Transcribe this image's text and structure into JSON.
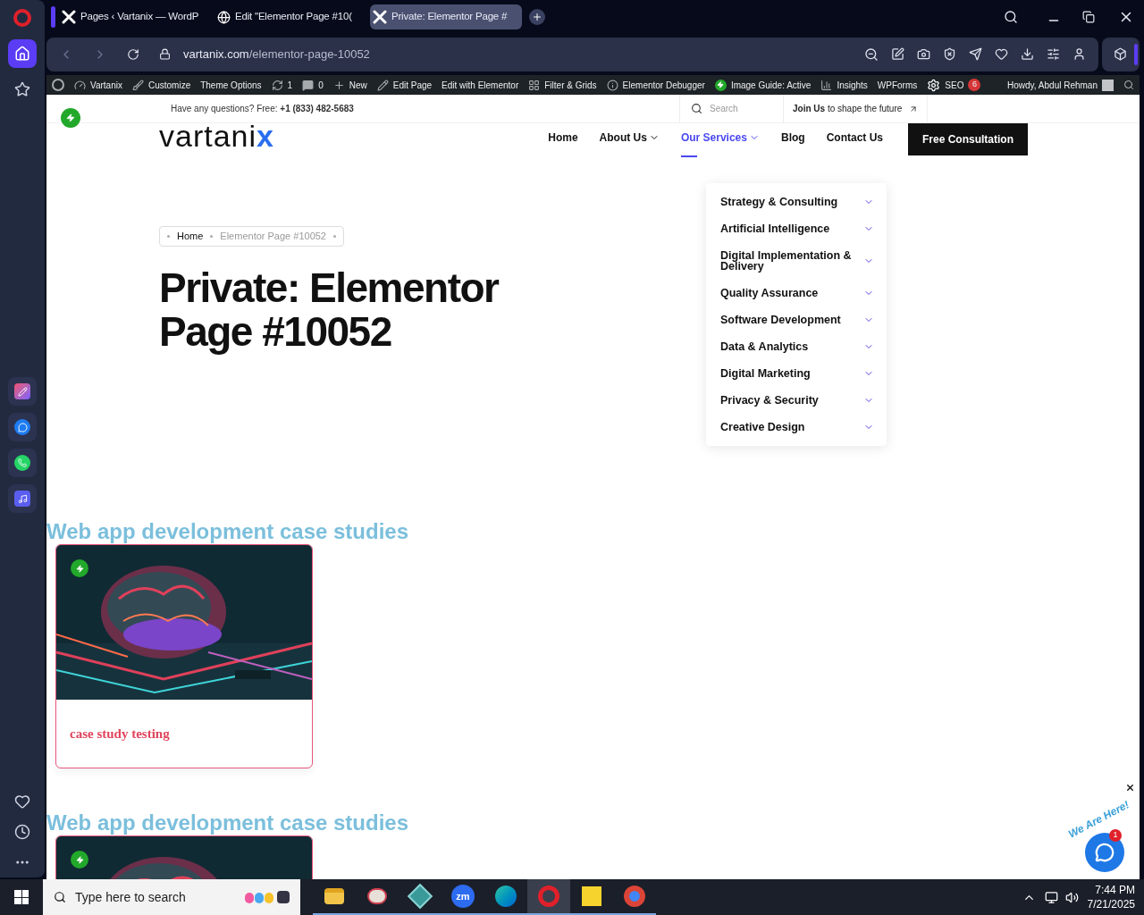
{
  "tabs": [
    {
      "kind": "logo",
      "title": "Pages ‹ Vartanix — WordP",
      "selected": false
    },
    {
      "kind": "globe",
      "title": "Edit \"Elementor Page #10(",
      "selected": false
    },
    {
      "kind": "logo",
      "title": "Private: Elementor Page #",
      "selected": true
    }
  ],
  "address": {
    "domain": "vartanix.com",
    "path": "/elementor-page-10052"
  },
  "opera_sidebar": [
    {
      "kind": "home",
      "selected": true
    },
    {
      "kind": "star",
      "selected": false
    },
    {
      "kind": "arc",
      "selected": false
    },
    {
      "kind": "messenger",
      "selected": false
    },
    {
      "kind": "whatsapp",
      "selected": false
    },
    {
      "kind": "music",
      "selected": false
    }
  ],
  "admin_bar": [
    {
      "kind": "wp"
    },
    {
      "kind": "site",
      "label": "Vartanix"
    },
    {
      "kind": "brush",
      "label": "Customize"
    },
    {
      "kind": "text",
      "label": "Theme Options"
    },
    {
      "kind": "updates",
      "label": "1"
    },
    {
      "kind": "comments",
      "label": "0"
    },
    {
      "kind": "new",
      "label": "New"
    },
    {
      "kind": "pencil",
      "label": "Edit Page"
    },
    {
      "kind": "text",
      "label": "Edit with Elementor"
    },
    {
      "kind": "grid",
      "label": "Filter & Grids"
    },
    {
      "kind": "info",
      "label": "Elementor Debugger"
    },
    {
      "kind": "bolt",
      "label": "Image Guide: Active"
    },
    {
      "kind": "bars",
      "label": "Insights"
    },
    {
      "kind": "text",
      "label": "WPForms"
    },
    {
      "kind": "seo",
      "label": "SEO",
      "badge": "6"
    }
  ],
  "admin_user": "Howdy, Abdul Rehman",
  "topbar": {
    "question": "Have any questions? Free: **+1 (833) 482-5683**",
    "search_placeholder": "Search",
    "join": "**Join Us** to shape the future"
  },
  "logo": {
    "main": "vartani",
    "accent": "x"
  },
  "nav": [
    {
      "label": "Home",
      "dropdown": false,
      "selected": false
    },
    {
      "label": "About Us",
      "dropdown": true,
      "selected": false
    },
    {
      "label": "Our Services",
      "dropdown": true,
      "selected": true
    },
    {
      "label": "Blog",
      "dropdown": false,
      "selected": false
    },
    {
      "label": "Contact Us",
      "dropdown": false,
      "selected": false
    }
  ],
  "cta": "Free Consultation",
  "services_menu": [
    "Strategy & Consulting",
    "Artificial Intelligence",
    "Digital Implementation & Delivery",
    "Quality Assurance",
    "Software Development",
    "Data & Analytics",
    "Digital Marketing",
    "Privacy & Security",
    "Creative Design"
  ],
  "breadcrumb": [
    "Home",
    "Elementor Page #10052"
  ],
  "title": "Private: Elementor Page #10052",
  "sections": [
    {
      "heading": "Web app development case studies",
      "card": {
        "kind": "picture",
        "title": "case study testing"
      }
    },
    {
      "heading": "Web app development case studies"
    }
  ],
  "chat": {
    "sticker": "We Are Here!",
    "badge": "1"
  },
  "taskbar": {
    "search_placeholder": "Type here to search",
    "time": "7:44 PM",
    "date": "7/21/2025",
    "apps": [
      {
        "kind": "folder",
        "running": true,
        "selected": false
      },
      {
        "kind": "paint",
        "running": true,
        "selected": false
      },
      {
        "kind": "cube",
        "running": true,
        "selected": false
      },
      {
        "kind": "zoom",
        "label": "zm",
        "running": true,
        "selected": false
      },
      {
        "kind": "edge",
        "running": true,
        "selected": false
      },
      {
        "kind": "opera",
        "running": true,
        "selected": true
      },
      {
        "kind": "notes",
        "running": true,
        "selected": false
      },
      {
        "kind": "chrome",
        "running": true,
        "selected": false
      }
    ]
  }
}
